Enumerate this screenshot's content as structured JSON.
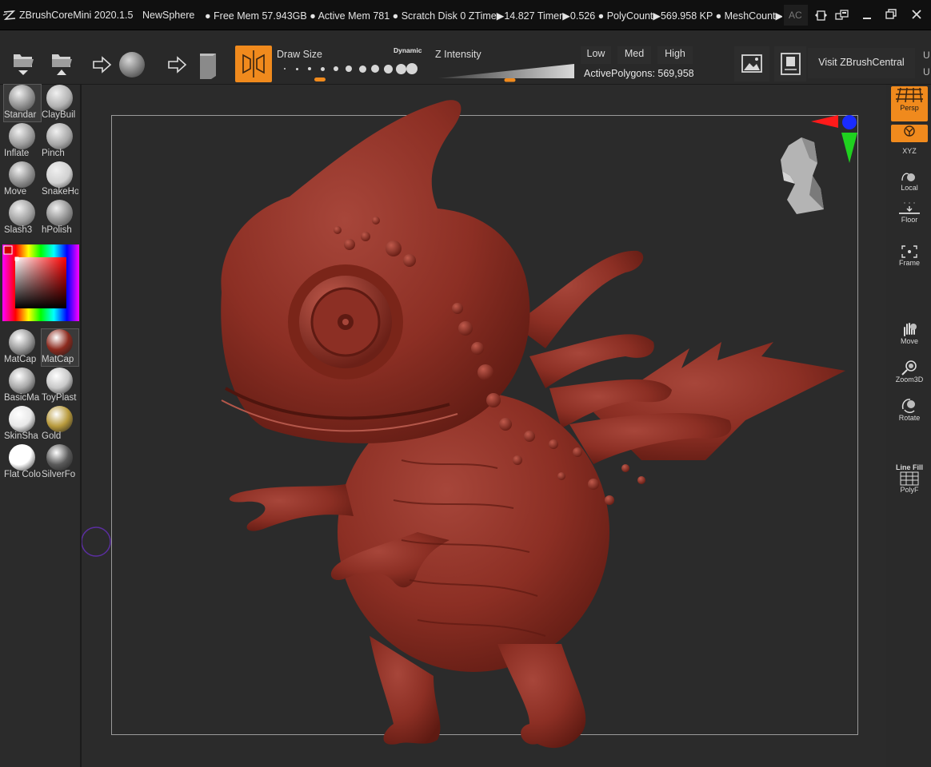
{
  "titlebar": {
    "app_title": "ZBrushCoreMini 2020.1.5",
    "document_name": "NewSphere",
    "stats": [
      "● Free Mem 57.943GB",
      "● Active Mem 781",
      "● Scratch Disk 0",
      "ZTime▶14.827",
      "Timer▶0.526",
      "● PolyCount▶569.958 KP",
      "● MeshCount▶"
    ],
    "truncated_menu": "AC"
  },
  "shelf": {
    "draw_size_label": "Draw Size",
    "dynamic_label": "Dynamic",
    "z_intensity_label": "Z Intensity",
    "draw_size_level": 0.25,
    "z_intensity_level": 0.5,
    "levels": [
      "Low",
      "Med",
      "High"
    ],
    "active_polygons": "ActivePolygons: 569,958",
    "visit_label": "Visit ZBrushCentral",
    "edge_letters": [
      "U",
      "U"
    ]
  },
  "brushes": [
    {
      "label": "Standar",
      "selected": true
    },
    {
      "label": "ClayBuil",
      "selected": false
    },
    {
      "label": "Inflate",
      "selected": false
    },
    {
      "label": "Pinch",
      "selected": false
    },
    {
      "label": "Move",
      "selected": false
    },
    {
      "label": "SnakeHo",
      "selected": false
    },
    {
      "label": "Slash3",
      "selected": false
    },
    {
      "label": "hPolish",
      "selected": false
    }
  ],
  "materials": [
    {
      "label": "MatCap",
      "color": "#9a9a9a"
    },
    {
      "label": "MatCap",
      "color": "#8c2a1e"
    },
    {
      "label": "BasicMa",
      "color": "#a8a8a8"
    },
    {
      "label": "ToyPlast",
      "color": "#c8c8c8"
    },
    {
      "label": "SkinSha",
      "color": "#e8e8e8"
    },
    {
      "label": "Gold",
      "color": "#b89a3c"
    },
    {
      "label": "Flat Colo",
      "color": "#ffffff"
    },
    {
      "label": "SilverFo",
      "color": "#5a5a5a"
    }
  ],
  "right_panel": {
    "persp": "Persp",
    "xyz": "XYZ",
    "local": "Local",
    "floor": "Floor",
    "frame": "Frame",
    "move": "Move",
    "zoom3d": "Zoom3D",
    "rotate": "Rotate",
    "line_fill": "Line Fill",
    "polyf": "PolyF"
  },
  "colors": {
    "accent": "#f08a1d",
    "model": "#8c2f24",
    "viewport_bg": "#2b2b2b"
  }
}
